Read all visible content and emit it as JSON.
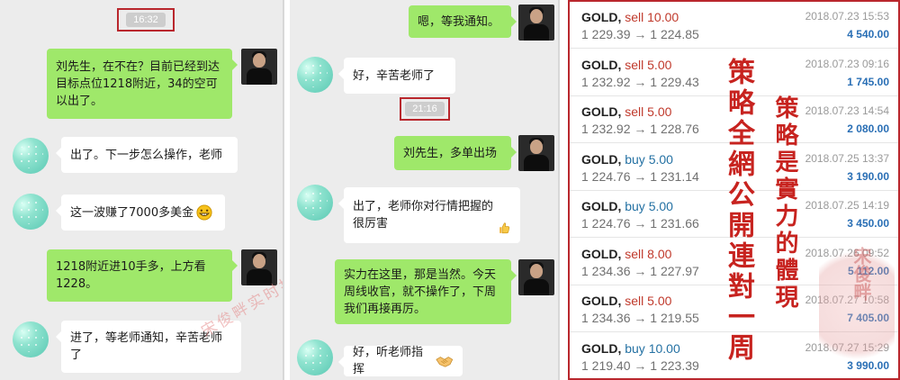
{
  "chat_left": {
    "time": "16:32",
    "messages": [
      {
        "side": "right",
        "text": "刘先生，在不在？目前已经到达目标点位1218附近，34的空可以出了。"
      },
      {
        "side": "left",
        "text": "出了。下一步怎么操作，老师"
      },
      {
        "side": "left",
        "text": "这一波赚了7000多美金",
        "emoji": "grin-emoji"
      },
      {
        "side": "right",
        "text": "1218附近进10手多，上方看1228。"
      },
      {
        "side": "left",
        "text": "进了，等老师通知，辛苦老师了"
      }
    ],
    "watermark": "宋俊畔实时指导操作"
  },
  "chat_right": {
    "time": "21:16",
    "messages": [
      {
        "side": "right",
        "text": "嗯，等我通知。"
      },
      {
        "side": "left",
        "text": "好，辛苦老师了"
      },
      {
        "side": "right",
        "text": "刘先生，多单出场"
      },
      {
        "side": "left",
        "text": "出了，老师你对行情把握的很厉害",
        "emoji": "thumbs-up-emoji"
      },
      {
        "side": "right",
        "text": "实力在这里，那是当然。今天周线收官，就不操作了，下周我们再接再厉。"
      },
      {
        "side": "left",
        "text": "好，听老师指挥",
        "emoji": "handshake-emoji"
      }
    ]
  },
  "trades": [
    {
      "symbol": "GOLD,",
      "side": "sell",
      "lots": "10.00",
      "date": "2018.07.23 15:53",
      "open": "1 229.39",
      "arrow": "→",
      "close": "1 224.85",
      "profit": "4 540.00"
    },
    {
      "symbol": "GOLD,",
      "side": "sell",
      "lots": "5.00",
      "date": "2018.07.23 09:16",
      "open": "1 232.92",
      "arrow": "→",
      "close": "1 229.43",
      "profit": "1 745.00"
    },
    {
      "symbol": "GOLD,",
      "side": "sell",
      "lots": "5.00",
      "date": "2018.07.23 14:54",
      "open": "1 232.92",
      "arrow": "→",
      "close": "1 228.76",
      "profit": "2 080.00"
    },
    {
      "symbol": "GOLD,",
      "side": "buy",
      "lots": "5.00",
      "date": "2018.07.25 13:37",
      "open": "1 224.76",
      "arrow": "→",
      "close": "1 231.14",
      "profit": "3 190.00"
    },
    {
      "symbol": "GOLD,",
      "side": "buy",
      "lots": "5.00",
      "date": "2018.07.25 14:19",
      "open": "1 224.76",
      "arrow": "→",
      "close": "1 231.66",
      "profit": "3 450.00"
    },
    {
      "symbol": "GOLD,",
      "side": "sell",
      "lots": "8.00",
      "date": "2018.07.26 09:52",
      "open": "1 234.36",
      "arrow": "→",
      "close": "1 227.97",
      "profit": "5 112.00"
    },
    {
      "symbol": "GOLD,",
      "side": "sell",
      "lots": "5.00",
      "date": "2018.07.27 10:58",
      "open": "1 234.36",
      "arrow": "→",
      "close": "1 219.55",
      "profit": "7 405.00"
    },
    {
      "symbol": "GOLD,",
      "side": "buy",
      "lots": "10.00",
      "date": "2018.07.27 15:29",
      "open": "1 219.40",
      "arrow": "→",
      "close": "1 223.39",
      "profit": "3 990.00"
    }
  ],
  "overlay": {
    "text1": "策略全網公開連對一周",
    "text2": "策略是實力的體現",
    "seal": "宋俊畔"
  },
  "colors": {
    "accent_red": "#c7231f",
    "bubble_green": "#9fe86a",
    "profit_blue": "#2a6fb5"
  }
}
